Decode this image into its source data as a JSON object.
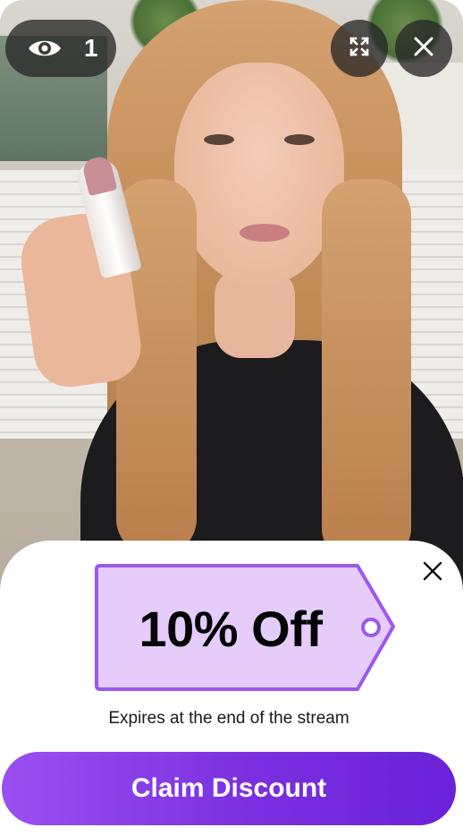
{
  "overlay": {
    "viewer_count": "1",
    "icons": {
      "viewers": "eye-icon",
      "expand": "expand-icon",
      "close": "close-icon"
    }
  },
  "offer": {
    "title": "10% Off",
    "expiry_text": "Expires at the end of the stream",
    "cta_label": "Claim Discount",
    "close_icon": "close-icon"
  },
  "colors": {
    "tag_fill": "#e5ccfb",
    "tag_border": "#9b59ea",
    "button_start": "#9a50f0",
    "button_end": "#6a22d8"
  }
}
